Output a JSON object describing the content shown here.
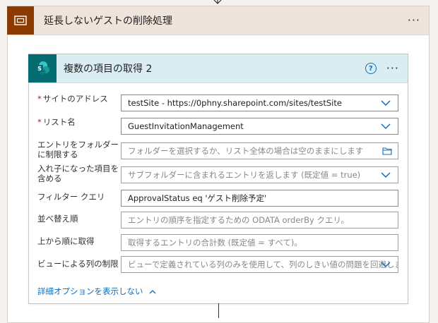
{
  "scope": {
    "title": "延長しないゲストの削除処理",
    "more_label": "···"
  },
  "card": {
    "title": "複数の項目の取得 2",
    "help_label": "?",
    "more_label": "···",
    "fields": [
      {
        "label": "サイトのアドレス",
        "required": true,
        "value": "testSite - https://0phny.sharepoint.com/sites/testSite",
        "placeholder": "",
        "control": "dropdown"
      },
      {
        "label": "リスト名",
        "required": true,
        "value": "GuestInvitationManagement",
        "placeholder": "",
        "control": "dropdown"
      },
      {
        "label": "エントリをフォルダーに制限する",
        "required": false,
        "value": "",
        "placeholder": "フォルダーを選択するか、リスト全体の場合は空のままにします",
        "control": "folder"
      },
      {
        "label": "入れ子になった項目を含める",
        "required": false,
        "value": "",
        "placeholder": "サブフォルダーに含まれるエントリを返します (既定値 = true)",
        "control": "dropdown"
      },
      {
        "label": "フィルター クエリ",
        "required": false,
        "value": "ApprovalStatus eq 'ゲスト削除予定'",
        "placeholder": "",
        "control": "text"
      },
      {
        "label": "並べ替え順",
        "required": false,
        "value": "",
        "placeholder": "エントリの順序を指定するための ODATA orderBy クエリ。",
        "control": "text"
      },
      {
        "label": "上から順に取得",
        "required": false,
        "value": "",
        "placeholder": "取得するエントリの合計数 (既定値 = すべて)。",
        "control": "text"
      },
      {
        "label": "ビューによる列の制限",
        "required": false,
        "value": "",
        "placeholder": "ビューで定義されている列のみを使用して、列のしきい値の問題を回避します",
        "control": "dropdown"
      }
    ],
    "advanced_toggle": "詳細オプションを表示しない"
  },
  "colors": {
    "scope_accent": "#8b3a00",
    "scope_header_bg": "#efe4dc",
    "card_accent": "#036c70",
    "card_header_bg": "#d9edf2",
    "link": "#0f6cbd",
    "required": "#a4262c"
  }
}
